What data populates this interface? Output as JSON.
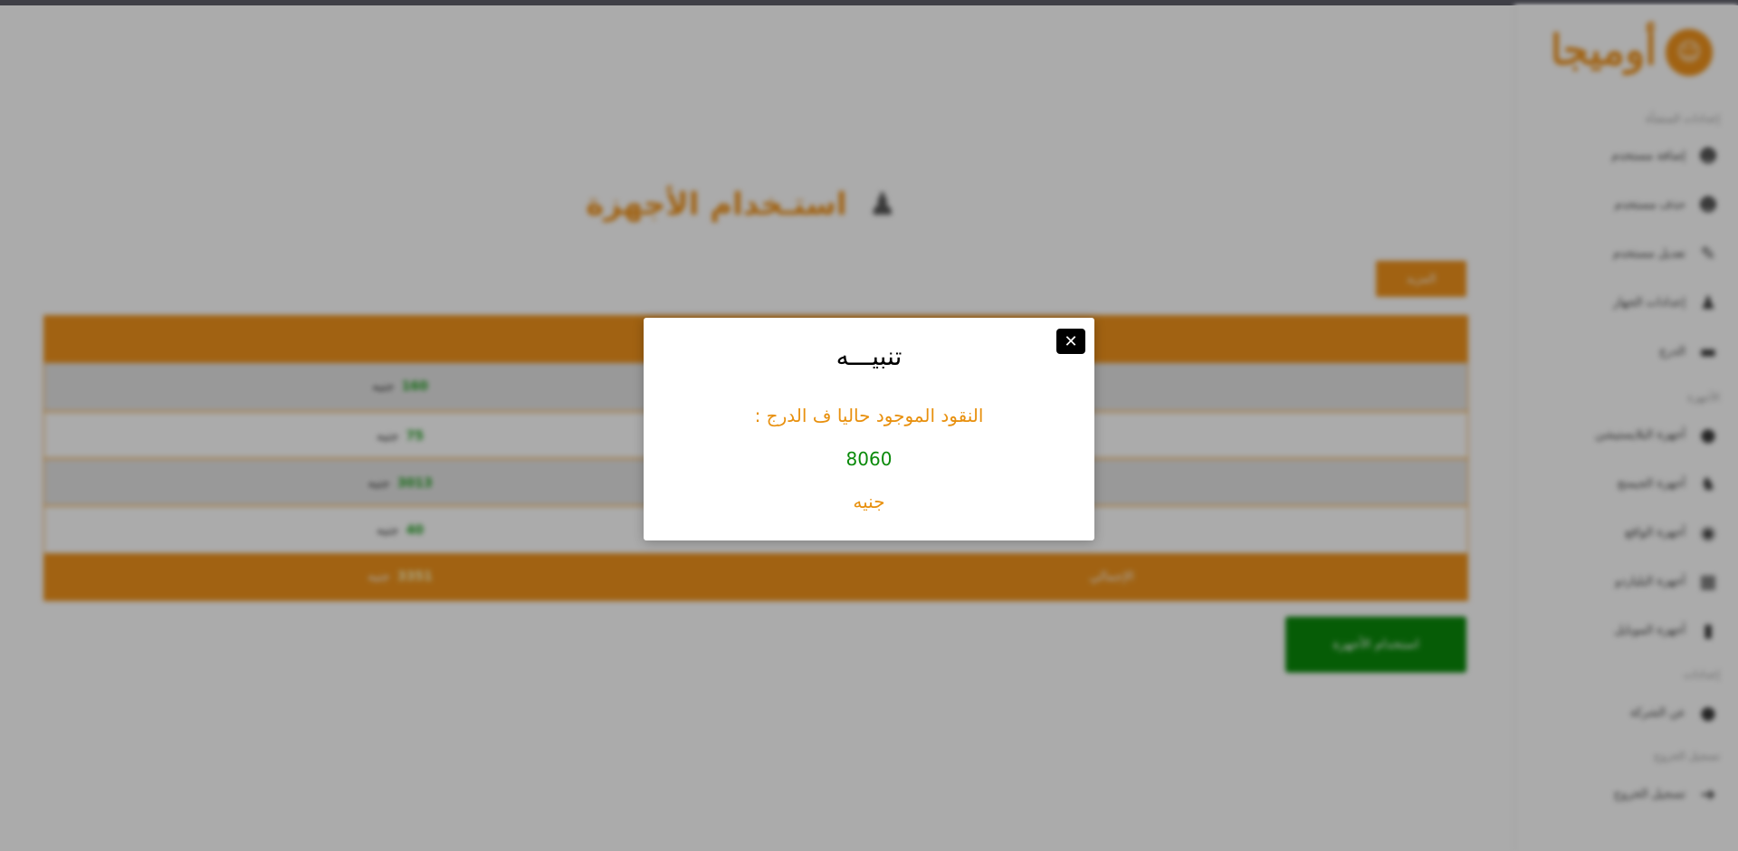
{
  "modal": {
    "close_symbol": "✕",
    "title": "تنبيـــه",
    "message": "النقود الموجود حاليا ف الدرج :",
    "amount": "8060",
    "currency": "جنيه"
  },
  "background": {
    "logo_text": "أوميجا",
    "page_title": "استـخدام الأجهزة",
    "top_button": "المزيد",
    "sidebar_sections": [
      "إعدادات المنشأة",
      "الأجهزة",
      "إعدادات",
      "تسجيل الخروج"
    ],
    "sidebar_items": [
      {
        "label": "إضافة مستخدم",
        "icon": "user-plus-icon"
      },
      {
        "label": "حذف مستخدم",
        "icon": "user-minus-icon"
      },
      {
        "label": "تعديل مستخدم",
        "icon": "user-edit-icon"
      },
      {
        "label": "إعدادات الجهاز",
        "icon": "joystick-icon"
      },
      {
        "label": "الدرج",
        "icon": "money-icon"
      },
      {
        "label": "أجهزة البلايستيشن",
        "icon": "gamepad-icon"
      },
      {
        "label": "أجهزة الجيمنج",
        "icon": "controller-icon"
      },
      {
        "label": "أجهزة الواقع",
        "icon": "vr-icon"
      },
      {
        "label": "أجهزة البلياردو",
        "icon": "table-icon"
      },
      {
        "label": "أجهزة الموبايل",
        "icon": "phone-icon"
      },
      {
        "label": "عن الشركة",
        "icon": "info-icon"
      },
      {
        "label": "تسجيل الخروج",
        "icon": "logout-icon"
      }
    ],
    "currency_unit": "جنيه",
    "table_rows": [
      {
        "value": "160"
      },
      {
        "value": "75"
      },
      {
        "value": "3013"
      },
      {
        "value": "40"
      }
    ],
    "total_label": "الإجمالي",
    "total_value": "3351",
    "bottom_button": "استخدام الأجهزة"
  }
}
